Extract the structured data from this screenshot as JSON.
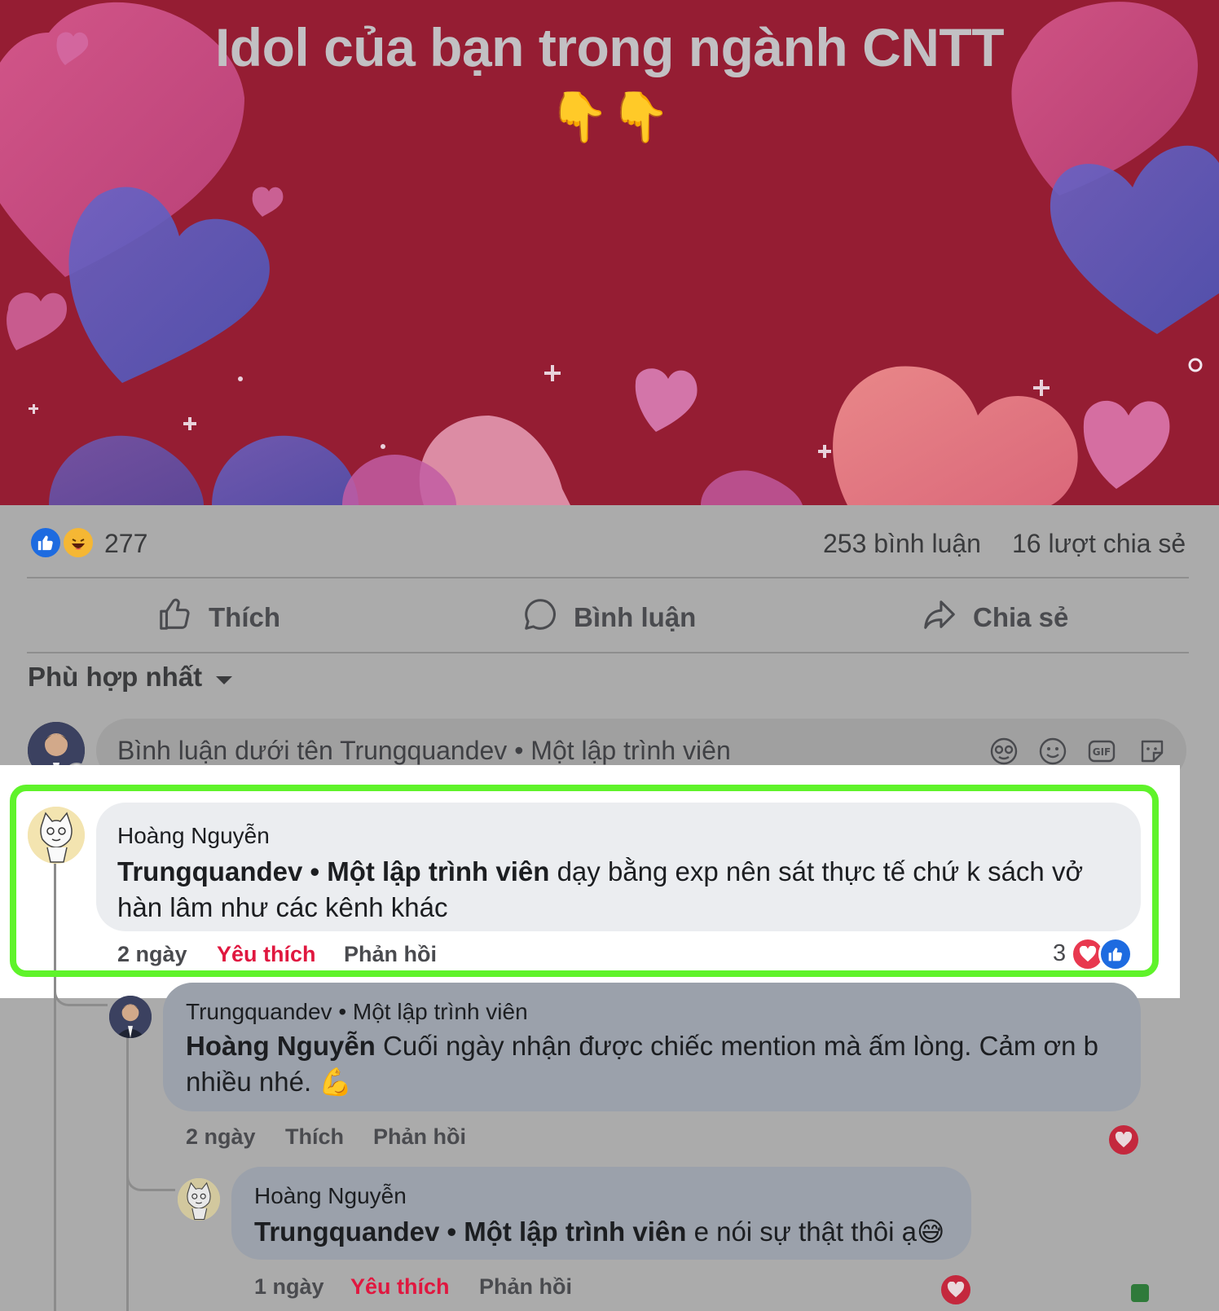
{
  "post": {
    "title": "Idol của bạn trong ngành CNTT",
    "emoji": "👇👇"
  },
  "stats": {
    "reaction_count": "277",
    "comment_count": "253 bình luận",
    "share_count": "16 lượt chia sẻ"
  },
  "actions": {
    "like": "Thích",
    "comment": "Bình luận",
    "share": "Chia sẻ"
  },
  "sort": {
    "label": "Phù hợp nhất"
  },
  "composer": {
    "placeholder": "Bình luận dưới tên Trungquandev • Một lập trình viên"
  },
  "comments": [
    {
      "author": "Hoàng Nguyễn",
      "mention": "Trungquandev • Một lập trình viên",
      "text_line1": " dạy bằng exp nên sát thực tế chứ k sách vở",
      "text_line2": "hàn lâm như các kênh khác",
      "time": "2 ngày",
      "like_label": "Yêu thích",
      "reply_label": "Phản hồi",
      "reaction_count": "3"
    },
    {
      "author": "Trungquandev • Một lập trình viên",
      "mention": "Hoàng Nguyễn",
      "text_line1": " Cuối ngày nhận được chiếc mention mà ấm lòng. Cảm ơn b",
      "text_line2": "nhiều nhé. 💪",
      "time": "2 ngày",
      "like_label": "Thích",
      "reply_label": "Phản hồi"
    },
    {
      "author": "Hoàng Nguyễn",
      "mention": "Trungquandev • Một lập trình viên",
      "text_line1": " e nói sự thật thôi ạ😅",
      "time": "1 ngày",
      "like_label": "Yêu thích",
      "reply_label": "Phản hồi"
    }
  ],
  "colors": {
    "banner_bg": "#951d33",
    "highlight_border": "#5ff32a",
    "liked_red": "#e0173f",
    "like_blue": "#1d6be0"
  }
}
